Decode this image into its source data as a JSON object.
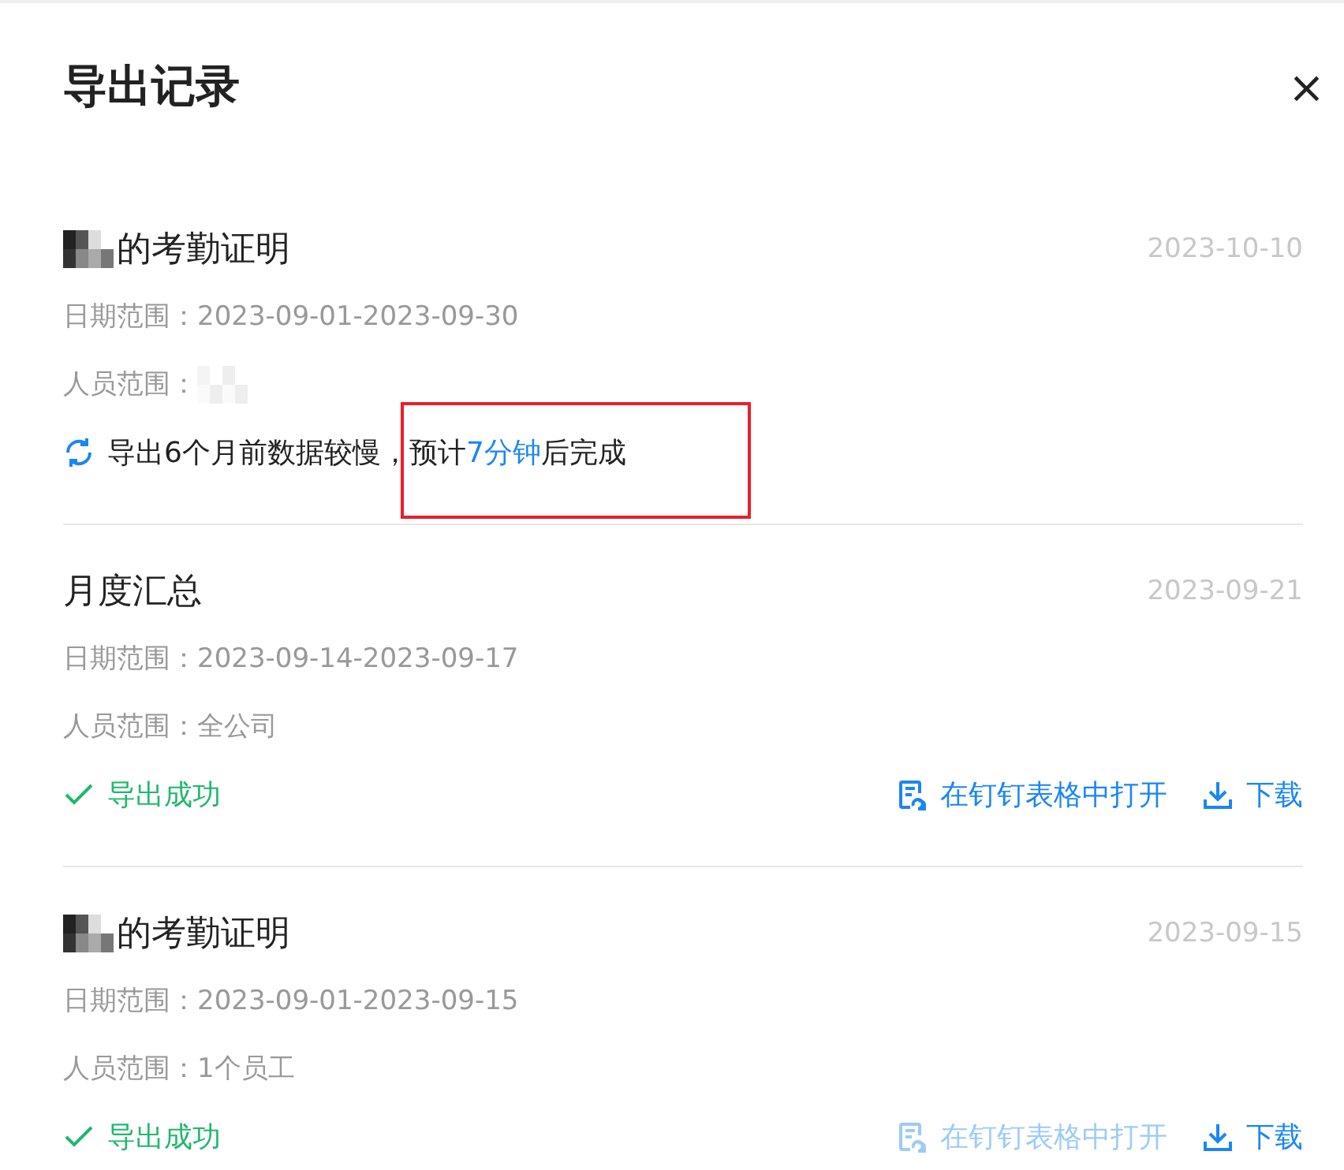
{
  "panel": {
    "title": "导出记录",
    "close": "×"
  },
  "records": [
    {
      "title": "的考勤证明",
      "title_redacted": true,
      "date": "2023-10-10",
      "date_range_label": "日期范围：",
      "date_range": "2023-09-01-2023-09-30",
      "people_label": "人员范围：",
      "people_redacted": true,
      "status": {
        "kind": "pending",
        "annotated": true,
        "parts": [
          {
            "text": "导出6个月前数据较慢，",
            "accent": false
          },
          {
            "text": "预计",
            "accent": false
          },
          {
            "text": "7分钟",
            "accent": true
          },
          {
            "text": "后完成",
            "accent": false
          }
        ]
      }
    },
    {
      "title": "月度汇总",
      "title_redacted": false,
      "date": "2023-09-21",
      "date_range_label": "日期范围：",
      "date_range": "2023-09-14-2023-09-17",
      "people_label": "人员范围：",
      "people": "全公司",
      "people_redacted": false,
      "status": {
        "kind": "success",
        "parts": [
          {
            "text": "导出成功",
            "accent": false
          }
        ]
      },
      "actions": [
        {
          "kind": "sheet",
          "label": "在钉钉表格中打开",
          "disabled": false
        },
        {
          "kind": "download",
          "label": "下载",
          "disabled": false
        }
      ]
    },
    {
      "title": "的考勤证明",
      "title_redacted": true,
      "date": "2023-09-15",
      "date_range_label": "日期范围：",
      "date_range": "2023-09-01-2023-09-15",
      "people_label": "人员范围：",
      "people": "1个员工",
      "people_redacted": false,
      "status": {
        "kind": "success",
        "parts": [
          {
            "text": "导出成功",
            "accent": false
          }
        ]
      },
      "actions": [
        {
          "kind": "sheet",
          "label": "在钉钉表格中打开",
          "disabled": true
        },
        {
          "kind": "download",
          "label": "下载",
          "disabled": false
        }
      ]
    }
  ]
}
